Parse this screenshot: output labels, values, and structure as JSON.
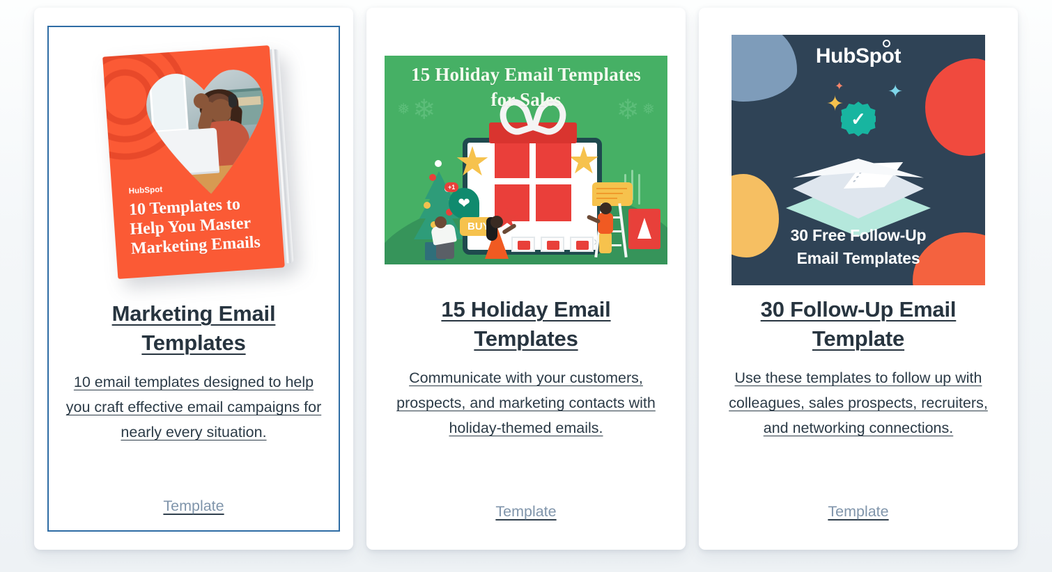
{
  "page": {
    "background_color": "#eef2f5",
    "layout": "three-column-resource-cards"
  },
  "cards": [
    {
      "id": "marketing-email-templates",
      "selected": true,
      "selection_border_color": "#2e6ca4",
      "title": "Marketing Email Templates",
      "description": "10 email templates designed to help you craft effective email campaigns for nearly every situation.",
      "link_label": "Template",
      "thumbnail": {
        "kind": "ebook-cover-mockup",
        "alt": "Tilted ebook cover titled 10 Templates to Help You Master Marketing Emails",
        "brand": "HubSpot",
        "cover_headline": "10 Templates to Help You Master Marketing Emails",
        "cover_bg_color": "#fb5a35",
        "photo_alt": "Smiling woman with headphones waving at a laptop during a video call"
      }
    },
    {
      "id": "15-holiday-email-templates",
      "selected": false,
      "title": "15 Holiday Email Templates",
      "description": "Communicate with your customers, prospects, and marketing contacts with holiday-themed emails.",
      "link_label": "Template",
      "thumbnail": {
        "kind": "holiday-illustration",
        "alt": "Green holiday illustration with a giant wrapped gift, Christmas tree and shoppers",
        "headline_line_1": "15 Holiday Email Templates",
        "headline_line_2": "for Sales",
        "bg_color": "#46b065",
        "ground_color": "#36945a",
        "badges": {
          "buy": "BUY",
          "like_count": "+1"
        }
      }
    },
    {
      "id": "30-follow-up-email-template",
      "selected": false,
      "title": "30 Follow-Up Email Template",
      "description": "Use these templates to follow up with colleagues, sales prospects, recruiters, and networking connections.",
      "link_label": "Template",
      "thumbnail": {
        "kind": "follow-up-graphic",
        "alt": "Dark navy graphic with an envelope, check badge and HubSpot logo",
        "brand": "HubSpot",
        "caption_line_1": "30 Free Follow-Up",
        "caption_line_2": "Email Templates",
        "bg_color": "#2f4356",
        "accent_colors": [
          "#7e9cba",
          "#f6bf62",
          "#f04a3e",
          "#f4623f",
          "#18b5a0"
        ]
      }
    }
  ]
}
